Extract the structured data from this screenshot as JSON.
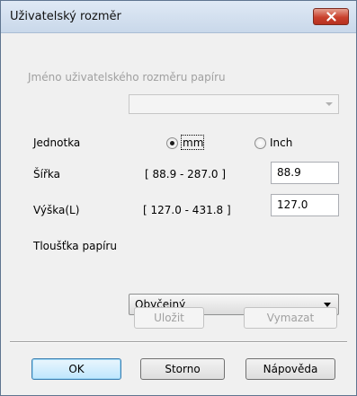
{
  "window": {
    "title": "Uživatelský rozměr"
  },
  "form": {
    "name_label": "Jméno uživatelského rozměru papíru",
    "name_value": "",
    "unit_label": "Jednotka",
    "unit_mm": "mm",
    "unit_inch": "Inch",
    "unit_selected": "mm",
    "width_label": "Šířka",
    "width_range": "[ 88.9 - 287.0 ]",
    "width_value": "88.9",
    "height_label": "Výška(L)",
    "height_range": "[ 127.0 - 431.8 ]",
    "height_value": "127.0",
    "thickness_label": "Tloušťka papíru",
    "thickness_value": "Obyčejný"
  },
  "buttons": {
    "save": "Uložit",
    "delete": "Vymazat",
    "ok": "OK",
    "cancel": "Storno",
    "help": "Nápověda"
  }
}
